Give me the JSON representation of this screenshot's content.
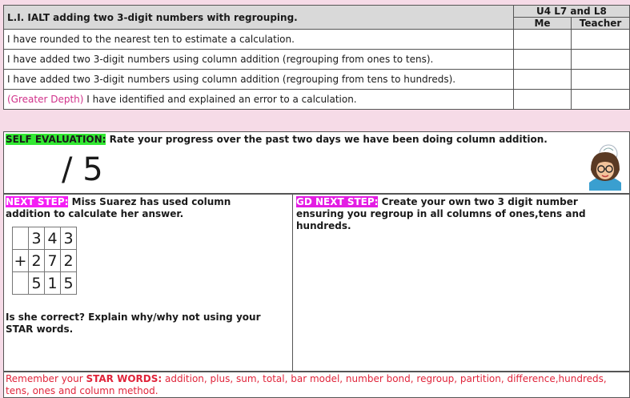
{
  "objective": {
    "title": "L.I. IALT adding two 3-digit numbers with regrouping.",
    "lesson_code": "U4 L7 and L8",
    "col_me": "Me",
    "col_teacher": "Teacher"
  },
  "criteria": [
    {
      "prefix": "",
      "text": "I have rounded to the nearest ten to estimate a calculation."
    },
    {
      "prefix": "",
      "text": "I have added two 3-digit numbers using column addition (regrouping from ones to tens)."
    },
    {
      "prefix": "",
      "text": "I have added two 3-digit numbers using column addition (regrouping from tens to hundreds)."
    },
    {
      "prefix": "(Greater Depth)",
      "text": " I have identified and explained an error to a calculation."
    }
  ],
  "self_eval": {
    "label": "SELF EVALUATION:",
    "text": " Rate your progress over the past two days we have been doing column addition.",
    "score": "/ 5"
  },
  "next_step": {
    "label": "NEXT STEP:",
    "text": " Miss Suarez has used column addition to calculate her answer.",
    "calc": [
      [
        "",
        "3",
        "4",
        "3"
      ],
      [
        "+",
        "2",
        "7",
        "2"
      ],
      [
        "",
        "5",
        "1",
        "5"
      ]
    ],
    "question": "Is she correct? Explain  why/why not using your STAR words."
  },
  "gd_next_step": {
    "label": "GD NEXT STEP:",
    "text": " Create your own two 3 digit number ensuring you regroup in all columns of ones,tens and hundreds."
  },
  "remember": {
    "prefix": "Remember your ",
    "label": "STAR WORDS:",
    "text": " addition, plus, sum, total, bar model, number bond, regroup, partition, difference,hundreds, tens, ones and column method."
  },
  "colors": {
    "background": "#f6dbe7",
    "highlight_green": "#33e833",
    "highlight_magenta": "#f41ef4",
    "reminder_red": "#e0243a"
  }
}
